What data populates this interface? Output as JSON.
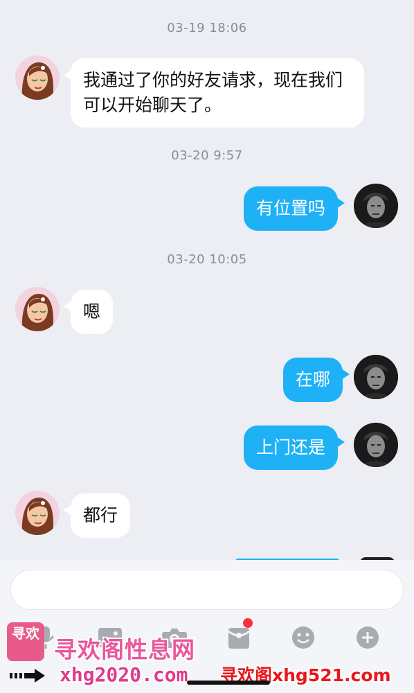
{
  "messages": [
    {
      "timestamp": "03-19 18:06"
    },
    {
      "text": "我通过了你的好友请求，现在我们可以开始聊天了。"
    },
    {
      "timestamp": "03-20 9:57"
    },
    {
      "text": "有位置吗"
    },
    {
      "timestamp": "03-20 10:05"
    },
    {
      "text": "嗯"
    },
    {
      "text": "在哪"
    },
    {
      "text": "上门还是"
    },
    {
      "text": "都行"
    }
  ],
  "input": {
    "value": ""
  },
  "toolbar": [
    "voice-icon",
    "image-icon",
    "camera-icon",
    "redpacket-icon",
    "emoji-icon",
    "plus-icon"
  ],
  "colors": {
    "sent_bubble": "#1eb1f6",
    "received_bubble": "#ffffff",
    "background": "#eceef4",
    "badge": "#f7333b"
  },
  "watermark": {
    "logo_text": "寻欢",
    "cn_text": "寻欢阁性息网",
    "url_left": "xhg2020.com",
    "url_right": "寻欢阁xhg521.com"
  }
}
